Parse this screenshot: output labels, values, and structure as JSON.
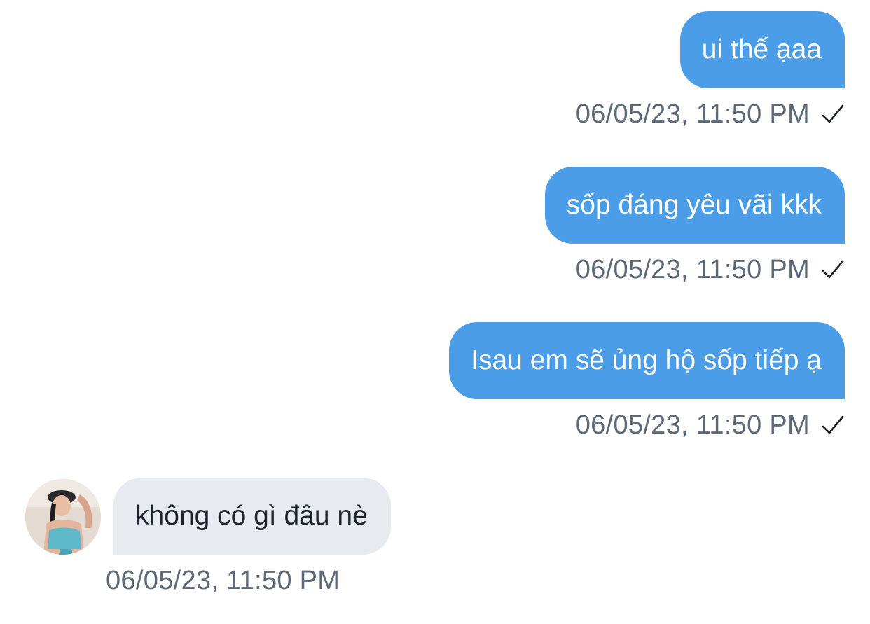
{
  "conversation": {
    "outgoing": [
      {
        "text": "ui thế ạaa",
        "timestamp": "06/05/23, 11:50 PM",
        "status_icon": "check-icon"
      },
      {
        "text": "sốp đáng yêu vãi kkk",
        "timestamp": "06/05/23, 11:50 PM",
        "status_icon": "check-icon"
      },
      {
        "text": "Isau em sẽ ủng hộ sốp tiếp ạ",
        "timestamp": "06/05/23, 11:50 PM",
        "status_icon": "check-icon"
      }
    ],
    "incoming": [
      {
        "text": "không có gì đâu nè",
        "timestamp": "06/05/23, 11:50 PM",
        "avatar_icon": "avatar-icon"
      }
    ]
  },
  "colors": {
    "outgoing_bubble": "#4c9de8",
    "incoming_bubble": "#e7eaee",
    "timestamp_text": "#5d6977"
  }
}
